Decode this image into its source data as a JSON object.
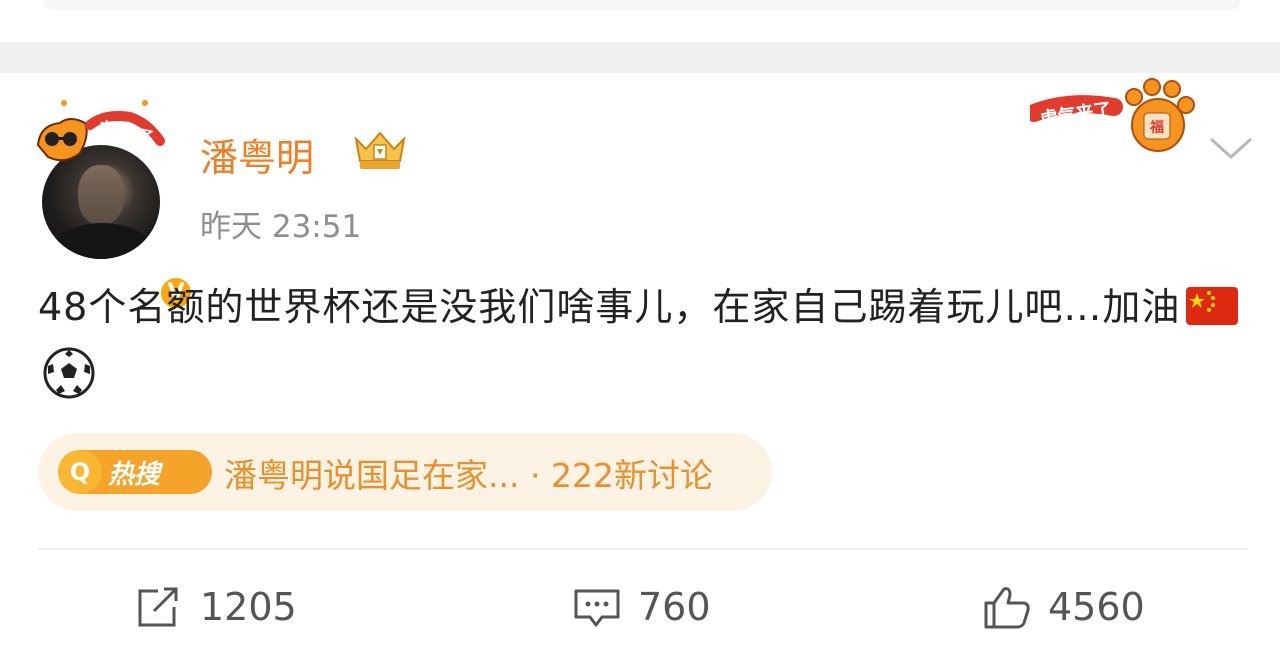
{
  "post": {
    "username": "潘粤明",
    "timestamp": "昨天 23:51",
    "verified_badge": "V",
    "content": "48个名额的世界杯还是没我们啥事儿，在家自己踢着玩儿吧…加油",
    "content_emojis": [
      "china-flag",
      "soccer-ball"
    ],
    "hot_search": {
      "badge_label": "热搜",
      "topic": "潘粤明说国足在家...",
      "separator": "·",
      "discussions": "222新讨论"
    },
    "decorations": {
      "avatar_frame_text": "虎气来了",
      "badge_text": "虎气来了"
    },
    "actions": {
      "repost_count": "1205",
      "comment_count": "760",
      "like_count": "4560"
    }
  },
  "colors": {
    "username": "#f27e23",
    "hot_pill_bg": "#fdf3e4",
    "hot_text": "#e9902b",
    "verified": "#f8a80c"
  }
}
